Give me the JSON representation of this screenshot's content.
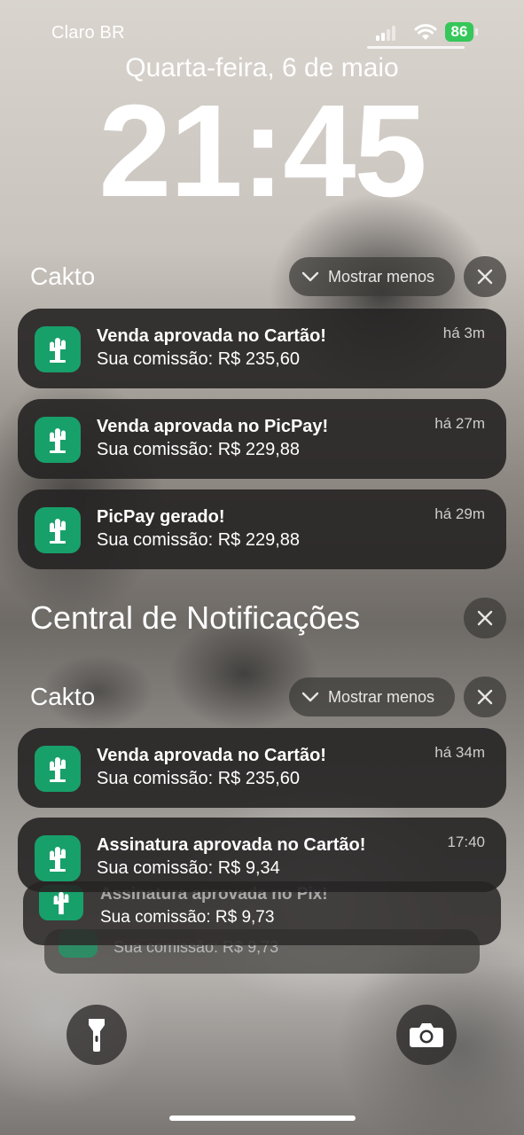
{
  "status": {
    "carrier": "Claro BR",
    "battery": "86"
  },
  "lock": {
    "date": "Quarta-feira, 6 de maio",
    "time": "21:45"
  },
  "groups": [
    {
      "app": "Cakto",
      "toggle_label": "Mostrar menos",
      "notifications": [
        {
          "title": "Venda aprovada no Cartão!",
          "body": "Sua comissão: R$ 235,60",
          "time": "há 3m"
        },
        {
          "title": "Venda aprovada no PicPay!",
          "body": "Sua comissão: R$ 229,88",
          "time": "há 27m"
        },
        {
          "title": "PicPay gerado!",
          "body": "Sua comissão: R$ 229,88",
          "time": "há 29m"
        }
      ]
    }
  ],
  "notification_center": {
    "title": "Central de Notificações",
    "group": {
      "app": "Cakto",
      "toggle_label": "Mostrar menos",
      "notifications": [
        {
          "title": "Venda aprovada no Cartão!",
          "body": "Sua comissão: R$ 235,60",
          "time": "há 34m"
        },
        {
          "title": "Assinatura aprovada no Cartão!",
          "body": "Sua comissão: R$ 9,34",
          "time": "17:40"
        }
      ],
      "stacked": [
        {
          "title": "Assinatura aprovada no Pix!",
          "body": "Sua comissão: R$ 9,73"
        },
        {
          "body": "Sua comissão: R$ 9,73"
        }
      ]
    }
  },
  "colors": {
    "app_icon": "#18a06a",
    "battery": "#35c759"
  },
  "icons": {
    "flashlight": "flashlight-icon",
    "camera": "camera-icon",
    "close": "close-icon",
    "chevron": "chevron-down-icon",
    "app": "cactus-icon"
  }
}
